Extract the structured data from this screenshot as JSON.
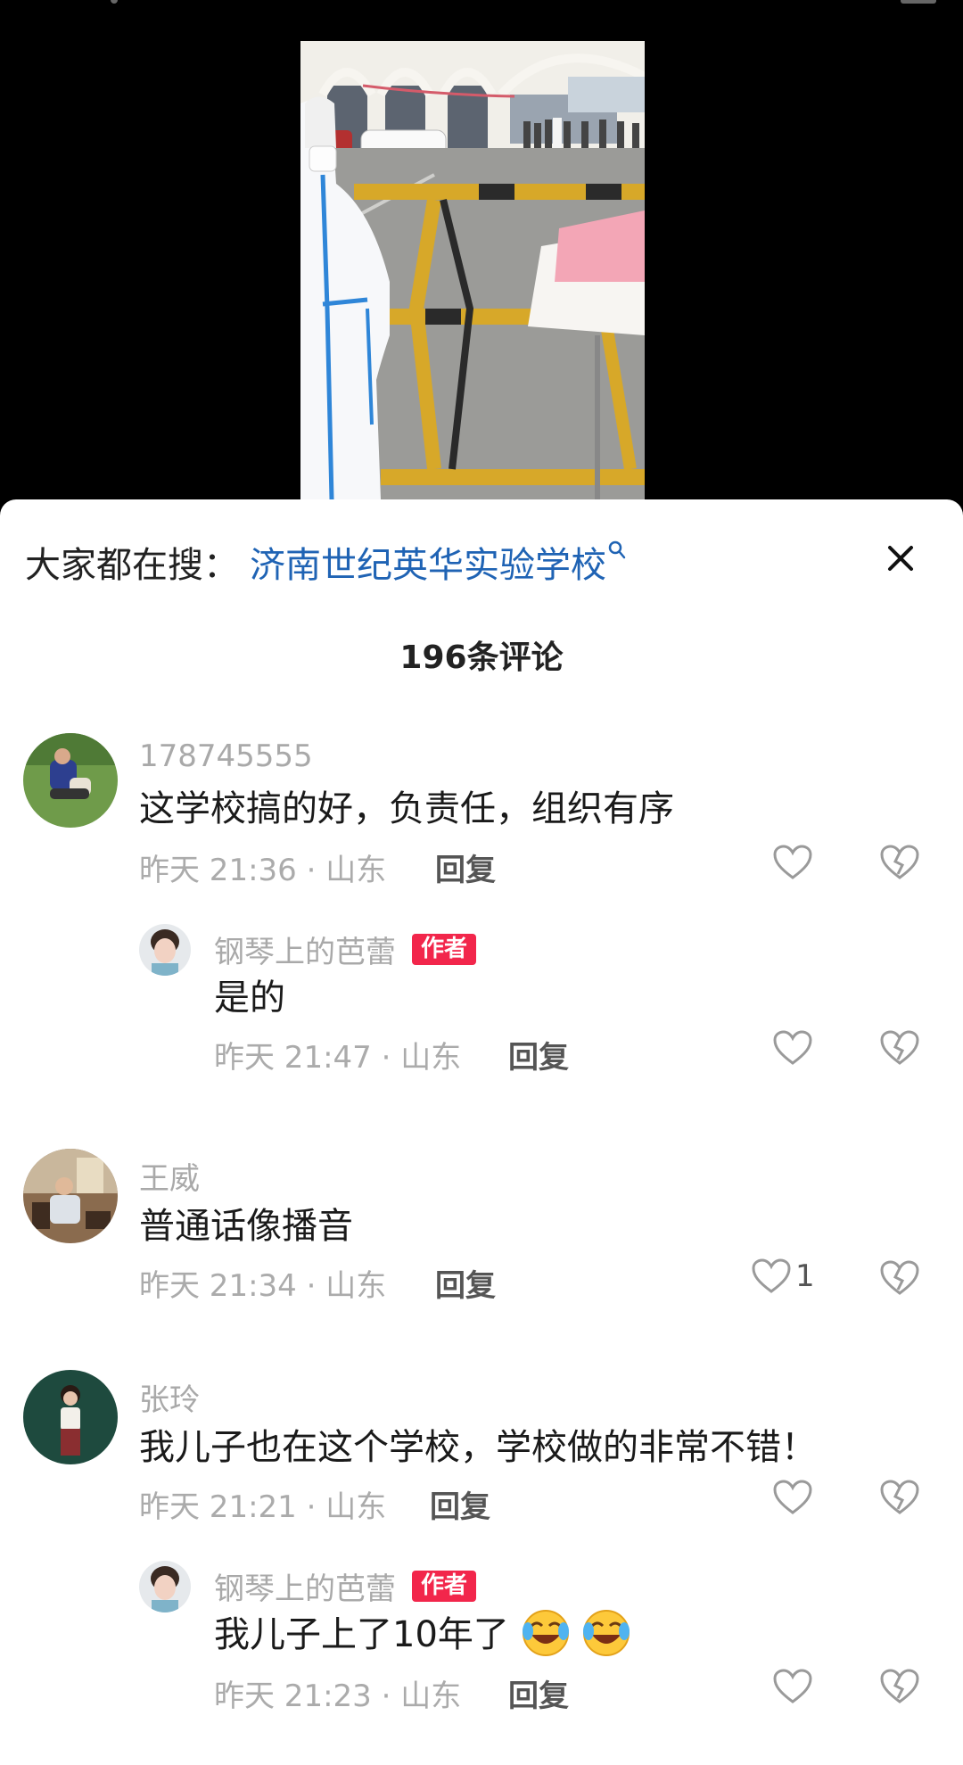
{
  "search": {
    "prefix": "大家都在搜：",
    "term": "济南世纪英华实验学校"
  },
  "comment_count_label": "196条评论",
  "comments": [
    {
      "username": "178745555",
      "text": "这学校搞的好，负责任，组织有序",
      "meta": "昨天 21:36 · 山东",
      "reply_label": "回复",
      "like_count": ""
    },
    {
      "username": "钢琴上的芭蕾",
      "badge": "作者",
      "text": "是的",
      "meta": "昨天 21:47 · 山东",
      "reply_label": "回复",
      "like_count": ""
    },
    {
      "username": "王威",
      "text": "普通话像播音",
      "meta": "昨天 21:34 · 山东",
      "reply_label": "回复",
      "like_count": "1"
    },
    {
      "username": "张玲",
      "text": "我儿子也在这个学校，学校做的非常不错！",
      "meta": "昨天 21:21 · 山东",
      "reply_label": "回复",
      "like_count": ""
    },
    {
      "username": "钢琴上的芭蕾",
      "badge": "作者",
      "text": "我儿子上了10年了",
      "emojis": [
        "laughing-crying-emoji",
        "laughing-crying-emoji"
      ],
      "meta": "昨天 21:23 · 山东",
      "reply_label": "回复",
      "like_count": ""
    }
  ],
  "icons": {
    "like": "heart-outline-icon",
    "dislike": "broken-heart-icon",
    "close": "close-x-icon",
    "search": "search-icon"
  },
  "colors": {
    "link": "#1f63b4",
    "badge": "#f2264b",
    "meta": "#ababab"
  }
}
